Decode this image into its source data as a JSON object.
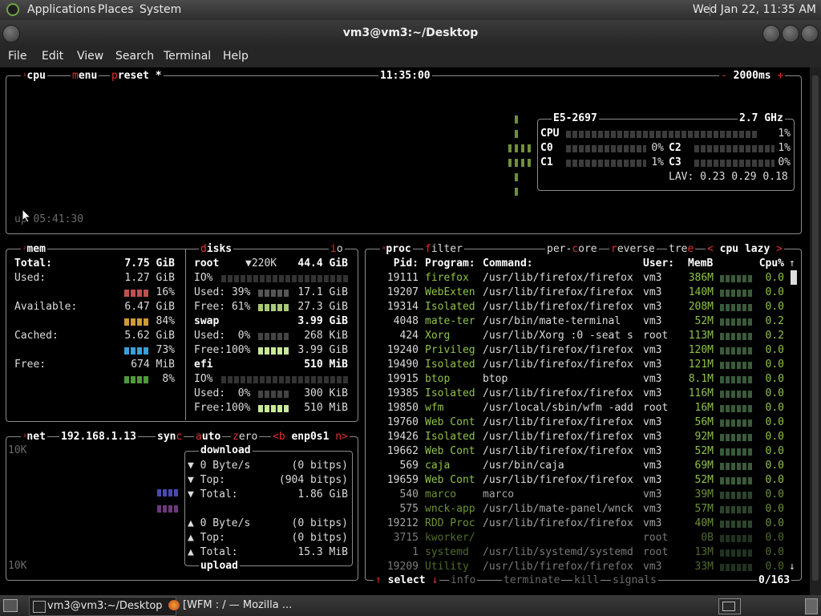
{
  "top_panel": {
    "menus": [
      "Applications",
      "Places",
      "System"
    ],
    "clock": "Wed Jan 22, 11:35 AM"
  },
  "window": {
    "title": "vm3@vm3:~/Desktop",
    "menubar": [
      "File",
      "Edit",
      "View",
      "Search",
      "Terminal",
      "Help"
    ]
  },
  "cpu_box": {
    "tab": "cpu",
    "menu": "menu",
    "preset": "preset *",
    "time": "11:35:00",
    "interval": "2000ms",
    "minus": "-",
    "plus": "+",
    "uptime": "up 05:41:30",
    "model": "E5-2697",
    "freq": "2.7 GHz",
    "cpu_label": "CPU",
    "cpu_pct": "1%",
    "cores": [
      {
        "name": "C0",
        "pct": "0%"
      },
      {
        "name": "C1",
        "pct": "1%"
      },
      {
        "name": "C2",
        "pct": "1%"
      },
      {
        "name": "C3",
        "pct": "0%"
      }
    ],
    "lav_label": "LAV:",
    "lav": [
      "0.23",
      "0.29",
      "0.18"
    ]
  },
  "mem_box": {
    "tab": "mem",
    "total_label": "Total:",
    "total": "7.75 GiB",
    "used_label": "Used:",
    "used": "1.27 GiB",
    "used_pct": "16%",
    "available_label": "Available:",
    "available": "6.47 GiB",
    "available_pct": "84%",
    "cached_label": "Cached:",
    "cached": "5.62 GiB",
    "cached_pct": "73%",
    "free_label": "Free:",
    "free": "674 MiB",
    "free_pct": "8%"
  },
  "disks_box": {
    "tab": "disks",
    "io_tab": "io",
    "root": {
      "name": "root",
      "free_io": "▼220K",
      "size": "44.4 GiB",
      "io_label": "IO%",
      "used_label": "Used: 39%",
      "used": "17.1 GiB",
      "free_label": "Free: 61%",
      "free": "27.3 GiB"
    },
    "swap": {
      "name": "swap",
      "size": "3.99 GiB",
      "used_label": "Used:  0%",
      "used": "268 KiB",
      "free_label": "Free:100%",
      "free": "3.99 GiB"
    },
    "efi": {
      "name": "efi",
      "size": "510 MiB",
      "io_label": "IO%",
      "used_label": "Used:  0%",
      "used": "300 KiB",
      "free_label": "Free:100%",
      "free": "510 MiB"
    }
  },
  "net_box": {
    "tab": "net",
    "ip": "192.168.1.13",
    "sync": "sync",
    "auto": "auto",
    "zero": "zero",
    "iface": "<b enp0s1 n>",
    "scale_top": "10K",
    "scale_bottom": "10K",
    "download_label": "download",
    "upload_label": "upload",
    "download": [
      {
        "arrow": "▼",
        "label": "0 Byte/s",
        "value": "(0 bitps)"
      },
      {
        "arrow": "▼",
        "label": "Top:",
        "value": "(904 bitps)"
      },
      {
        "arrow": "▼",
        "label": "Total:",
        "value": "1.86 GiB"
      }
    ],
    "upload": [
      {
        "arrow": "▲",
        "label": "0 Byte/s",
        "value": "(0 bitps)"
      },
      {
        "arrow": "▲",
        "label": "Top:",
        "value": "(0 bitps)"
      },
      {
        "arrow": "▲",
        "label": "Total:",
        "value": "15.3 MiB"
      }
    ]
  },
  "proc_box": {
    "tab": "proc",
    "filter": "filter",
    "per_core": "per-core",
    "reverse": "reverse",
    "tree": "tree",
    "sort": "cpu lazy",
    "sort_left": "<",
    "sort_right": ">",
    "headers": {
      "pid": "Pid:",
      "program": "Program:",
      "command": "Command:",
      "user": "User:",
      "mem": "MemB",
      "cpu": "Cpu%"
    },
    "rows": [
      {
        "pid": "19111",
        "program": "firefox",
        "command": "/usr/lib/firefox/firefox",
        "user": "vm3",
        "mem": "386M",
        "cpu": "0.0"
      },
      {
        "pid": "19207",
        "program": "WebExten",
        "command": "/usr/lib/firefox/firefox",
        "user": "vm3",
        "mem": "140M",
        "cpu": "0.0"
      },
      {
        "pid": "19314",
        "program": "Isolated",
        "command": "/usr/lib/firefox/firefox",
        "user": "vm3",
        "mem": "208M",
        "cpu": "0.0"
      },
      {
        "pid": "4048",
        "program": "mate-ter",
        "command": "/usr/bin/mate-terminal",
        "user": "vm3",
        "mem": "52M",
        "cpu": "0.2"
      },
      {
        "pid": "424",
        "program": "Xorg",
        "command": "/usr/lib/Xorg :0 -seat s",
        "user": "root",
        "mem": "113M",
        "cpu": "0.2"
      },
      {
        "pid": "19240",
        "program": "Privileg",
        "command": "/usr/lib/firefox/firefox",
        "user": "vm3",
        "mem": "120M",
        "cpu": "0.0"
      },
      {
        "pid": "19490",
        "program": "Isolated",
        "command": "/usr/lib/firefox/firefox",
        "user": "vm3",
        "mem": "121M",
        "cpu": "0.0"
      },
      {
        "pid": "19915",
        "program": "btop",
        "command": "btop",
        "user": "vm3",
        "mem": "8.1M",
        "cpu": "0.0"
      },
      {
        "pid": "19385",
        "program": "Isolated",
        "command": "/usr/lib/firefox/firefox",
        "user": "vm3",
        "mem": "116M",
        "cpu": "0.0"
      },
      {
        "pid": "19850",
        "program": "wfm",
        "command": "/usr/local/sbin/wfm -add",
        "user": "root",
        "mem": "16M",
        "cpu": "0.0"
      },
      {
        "pid": "19760",
        "program": "Web Cont",
        "command": "/usr/lib/firefox/firefox",
        "user": "vm3",
        "mem": "56M",
        "cpu": "0.0"
      },
      {
        "pid": "19426",
        "program": "Isolated",
        "command": "/usr/lib/firefox/firefox",
        "user": "vm3",
        "mem": "92M",
        "cpu": "0.0"
      },
      {
        "pid": "19662",
        "program": "Web Cont",
        "command": "/usr/lib/firefox/firefox",
        "user": "vm3",
        "mem": "52M",
        "cpu": "0.0"
      },
      {
        "pid": "569",
        "program": "caja",
        "command": "/usr/bin/caja",
        "user": "vm3",
        "mem": "69M",
        "cpu": "0.0"
      },
      {
        "pid": "19659",
        "program": "Web Cont",
        "command": "/usr/lib/firefox/firefox",
        "user": "vm3",
        "mem": "52M",
        "cpu": "0.0"
      },
      {
        "pid": "540",
        "program": "marco",
        "command": "marco",
        "user": "vm3",
        "mem": "39M",
        "cpu": "0.0"
      },
      {
        "pid": "575",
        "program": "wnck-app",
        "command": "/usr/lib/mate-panel/wnck",
        "user": "vm3",
        "mem": "57M",
        "cpu": "0.0"
      },
      {
        "pid": "19212",
        "program": "RDD Proc",
        "command": "/usr/lib/firefox/firefox",
        "user": "vm3",
        "mem": "40M",
        "cpu": "0.0"
      },
      {
        "pid": "3715",
        "program": "kworker/",
        "command": "",
        "user": "root",
        "mem": "0B",
        "cpu": "0.0"
      },
      {
        "pid": "1",
        "program": "systemd",
        "command": "/usr/lib/systemd/systemd",
        "user": "root",
        "mem": "13M",
        "cpu": "0.0"
      },
      {
        "pid": "19209",
        "program": "Utility",
        "command": "/usr/lib/firefox/firefox",
        "user": "vm3",
        "mem": "33M",
        "cpu": "0.0"
      }
    ],
    "footer": {
      "select": "select",
      "info": "info",
      "terminate": "terminate",
      "kill": "kill",
      "signals": "signals",
      "count": "0/163"
    }
  },
  "taskbar": {
    "tasks": [
      "vm3@vm3:~/Desktop",
      "[WFM : / — Mozilla ..."
    ]
  },
  "colors": {
    "accent_red": "#e03030",
    "accent_green": "#8fc24a",
    "border": "#8a8a8a",
    "text": "#dcdcdc",
    "dim": "#6b6b6b",
    "mem_used": "#c05050",
    "mem_available": "#d09a3a",
    "mem_cached": "#3aa0d8",
    "mem_free": "#4e9a3a"
  }
}
